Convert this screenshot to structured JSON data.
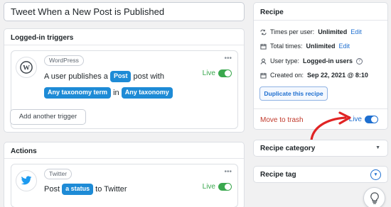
{
  "recipe_title": "Tweet When a New Post is Published",
  "triggers": {
    "heading": "Logged-in triggers",
    "integration": "WordPress",
    "sentence": {
      "part1": "A user publishes a",
      "token_post": "Post",
      "part2": "post with",
      "token_term": "Any taxonomy term",
      "part3": "in",
      "token_tax": "Any taxonomy"
    },
    "status": "Live",
    "add_button": "Add another trigger"
  },
  "actions": {
    "heading": "Actions",
    "integration": "Twitter",
    "sentence": {
      "part1": "Post",
      "token_status": "a status",
      "part2": "to Twitter"
    },
    "status": "Live"
  },
  "recipe_panel": {
    "heading": "Recipe",
    "times_per_user_label": "Times per user:",
    "times_per_user_value": "Unlimited",
    "total_times_label": "Total times:",
    "total_times_value": "Unlimited",
    "edit_label": "Edit",
    "user_type_label": "User type:",
    "user_type_value": "Logged-in users",
    "help_glyph": "?",
    "created_label": "Created on:",
    "created_value": "Sep 22, 2021 @ 8:10",
    "duplicate_button": "Duplicate this recipe",
    "trash_link": "Move to trash",
    "status": "Live"
  },
  "recipe_category": {
    "heading": "Recipe category"
  },
  "recipe_tag": {
    "heading": "Recipe tag"
  },
  "colors": {
    "accent": "#1e8bd6",
    "live_green": "#3aa84e",
    "live_blue": "#1e6fd0",
    "danger": "#c0392b",
    "annotation": "#e02424"
  }
}
